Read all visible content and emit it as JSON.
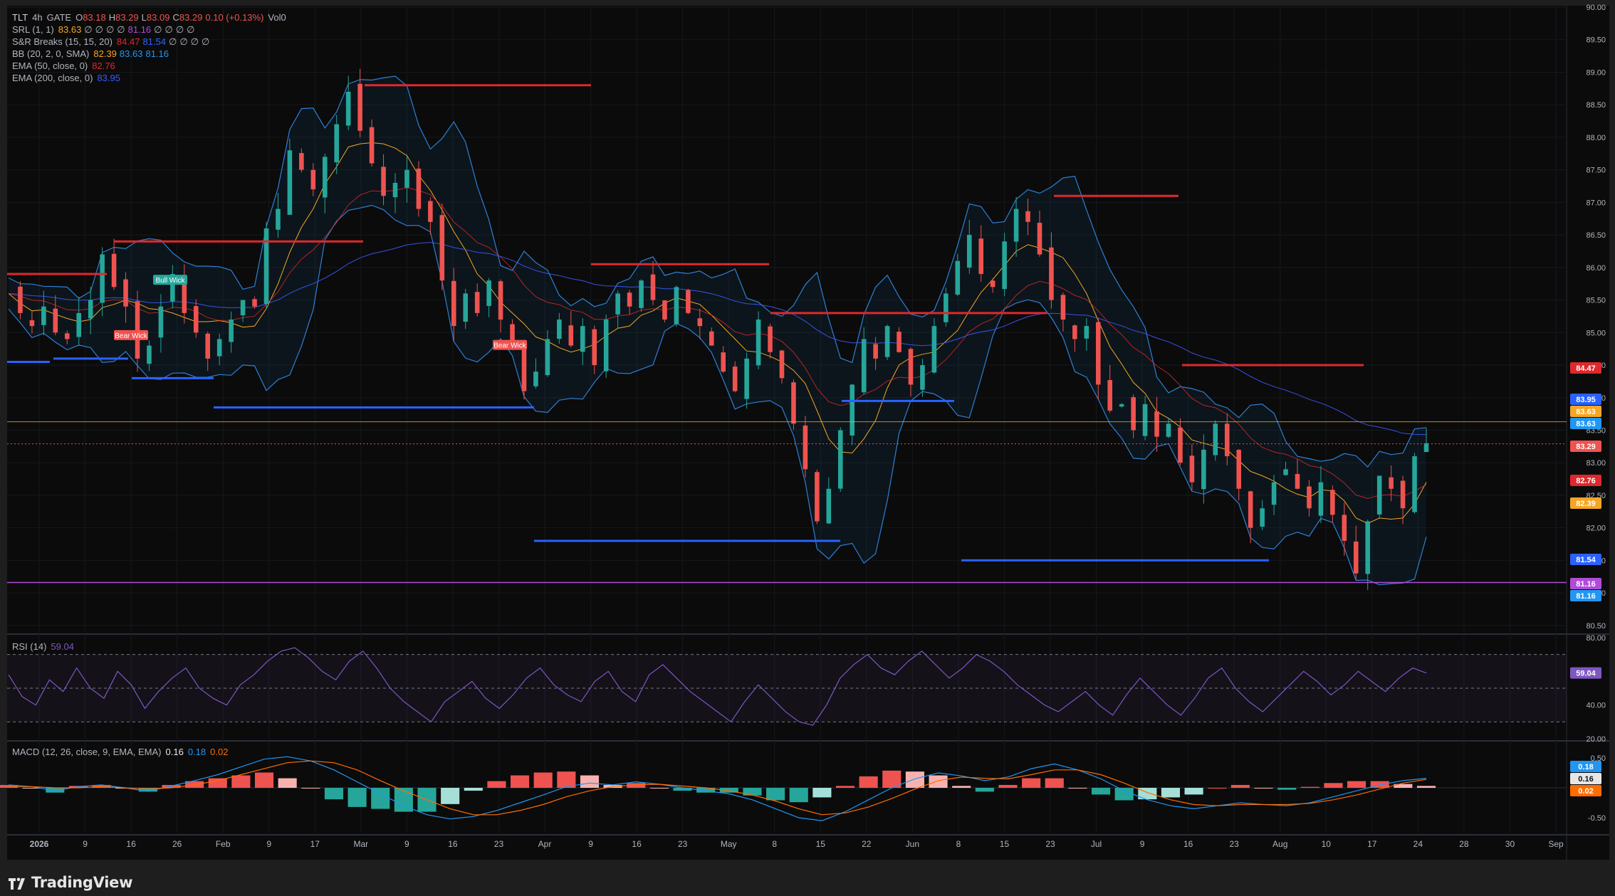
{
  "header": {
    "symbol": "TLT",
    "interval": "4h",
    "exchange": "GATE",
    "open_label": "O",
    "open": "83.18",
    "high_label": "H",
    "high": "83.29",
    "low_label": "L",
    "low": "83.09",
    "close_label": "C",
    "close": "83.29",
    "change": "0.10 (+0.13%)",
    "volume": "Vol0"
  },
  "indicators": [
    {
      "label": "SRL (1, 1)",
      "values": [
        "83.63",
        "∅",
        "∅",
        "∅",
        "∅",
        "81.16",
        "∅",
        "∅",
        "∅",
        "∅"
      ],
      "colors": [
        "#f5a623",
        "#b2b5be",
        "#b2b5be",
        "#b2b5be",
        "#b2b5be",
        "#b04cd9",
        "#b2b5be",
        "#b2b5be",
        "#b2b5be",
        "#b2b5be"
      ]
    },
    {
      "label": "S&R Breaks (15, 15, 20)",
      "values": [
        "84.47",
        "81.54",
        "∅",
        "∅",
        "∅",
        "∅"
      ],
      "colors": [
        "#e0282c",
        "#2962ff",
        "#b2b5be",
        "#b2b5be",
        "#b2b5be",
        "#b2b5be"
      ]
    },
    {
      "label": "BB (20, 2, 0, SMA)",
      "values": [
        "82.39",
        "83.63",
        "81.16"
      ],
      "colors": [
        "#f5a623",
        "#2196f3",
        "#2196f3"
      ]
    },
    {
      "label": "EMA (50, close, 0)",
      "values": [
        "82.76"
      ],
      "colors": [
        "#e0282c"
      ]
    },
    {
      "label": "EMA (200, close, 0)",
      "values": [
        "83.95"
      ],
      "colors": [
        "#3d5afe"
      ]
    }
  ],
  "colors": {
    "up": "#26a69a",
    "down": "#ef5350",
    "resistance": "#e0282c",
    "support": "#2962ff",
    "bb": "#2f7fd6",
    "ema50": "#e0282c",
    "ema200": "#3d5afe",
    "basis": "#f5a623",
    "rsi": "#7e57c2",
    "macd": "#2196f3",
    "signal": "#ff6d00"
  },
  "chart_data": [
    {
      "type": "candlestick",
      "title": "",
      "y_axis_ticks": [
        "90.00",
        "89.50",
        "89.00",
        "88.50",
        "88.00",
        "87.50",
        "87.00",
        "86.50",
        "86.00",
        "85.50",
        "85.00",
        "84.50",
        "84.00",
        "83.50",
        "83.00",
        "82.50",
        "82.00",
        "81.50",
        "81.00",
        "80.50"
      ],
      "ylim": [
        80.4,
        90.0
      ],
      "x_axis_ticks": [
        "2026",
        "9",
        "16",
        "26",
        "Feb",
        "9",
        "17",
        "Mar",
        "9",
        "16",
        "23",
        "Apr",
        "9",
        "16",
        "23",
        "May",
        "8",
        "15",
        "22",
        "Jun",
        "8",
        "15",
        "23",
        "Jul",
        "9",
        "16",
        "23",
        "Aug",
        "10",
        "17",
        "24",
        "28",
        "30",
        "Sep"
      ],
      "close_path": [
        85.6,
        85.3,
        85.1,
        85.4,
        85.0,
        84.9,
        85.3,
        85.5,
        86.2,
        85.7,
        85.4,
        84.6,
        84.8,
        85.4,
        85.9,
        85.3,
        85.0,
        84.6,
        84.9,
        85.2,
        85.5,
        85.4,
        86.6,
        86.9,
        87.8,
        87.5,
        87.2,
        87.7,
        88.2,
        88.7,
        88.1,
        87.6,
        87.1,
        87.3,
        87.5,
        86.9,
        86.7,
        85.8,
        85.1,
        85.6,
        85.3,
        85.8,
        85.2,
        84.8,
        84.1,
        84.4,
        84.9,
        85.2,
        84.8,
        85.1,
        84.5,
        85.2,
        85.6,
        85.4,
        85.8,
        85.5,
        85.2,
        85.7,
        85.3,
        85.1,
        84.8,
        84.4,
        84.1,
        84.6,
        85.2,
        84.7,
        84.3,
        83.6,
        82.9,
        82.1,
        82.6,
        83.5,
        84.2,
        84.9,
        84.6,
        85.1,
        84.7,
        84.2,
        84.5,
        85.1,
        85.6,
        86.1,
        86.5,
        85.9,
        85.7,
        86.4,
        86.9,
        86.7,
        86.2,
        85.5,
        85.2,
        84.9,
        85.1,
        84.2,
        83.8,
        83.9,
        83.5,
        83.9,
        83.4,
        83.6,
        83.0,
        82.7,
        83.2,
        83.6,
        83.1,
        82.6,
        82.0,
        82.3,
        82.7,
        82.9,
        82.6,
        82.3,
        82.7,
        82.2,
        81.8,
        81.3,
        82.1,
        82.8,
        82.6,
        82.3,
        83.1,
        83.3
      ],
      "resistance_levels": [
        85.9,
        86.4,
        88.8,
        86.05,
        85.3,
        87.1,
        84.5
      ],
      "support_levels": [
        84.55,
        84.6,
        84.3,
        83.85,
        81.8,
        83.95,
        81.5
      ],
      "labels": [
        "Bull Wick",
        "Bear Wick",
        "Bear Wick"
      ],
      "price_axis_labels": [
        {
          "value": "84.47",
          "bg": "#e0282c"
        },
        {
          "value": "83.95",
          "bg": "#2962ff"
        },
        {
          "value": "83.63",
          "bg": "#f5a623"
        },
        {
          "value": "83.63",
          "bg": "#2196f3"
        },
        {
          "value": "83.29",
          "bg": "#ef5350"
        },
        {
          "value": "82.76",
          "bg": "#e0282c"
        },
        {
          "value": "82.39",
          "bg": "#f5a623"
        },
        {
          "value": "81.54",
          "bg": "#2962ff"
        },
        {
          "value": "81.16",
          "bg": "#b04cd9"
        },
        {
          "value": "81.16",
          "bg": "#2196f3"
        }
      ],
      "horizontal_lines": [
        83.63,
        81.16
      ]
    },
    {
      "type": "line",
      "title": "RSI (14)",
      "value": "59.04",
      "y_axis_ticks": [
        "80.00",
        "40.00",
        "20.00"
      ],
      "ylim": [
        20,
        80
      ],
      "bands": [
        70,
        50,
        30
      ],
      "series": [
        {
          "name": "RSI",
          "values": [
            58,
            45,
            40,
            55,
            48,
            62,
            50,
            44,
            60,
            52,
            38,
            48,
            56,
            62,
            50,
            44,
            40,
            52,
            58,
            66,
            72,
            74,
            68,
            60,
            55,
            66,
            72,
            62,
            50,
            42,
            36,
            30,
            42,
            48,
            54,
            44,
            38,
            46,
            56,
            62,
            52,
            46,
            42,
            54,
            60,
            48,
            42,
            58,
            64,
            56,
            48,
            42,
            36,
            30,
            42,
            52,
            44,
            36,
            30,
            28,
            40,
            56,
            64,
            70,
            62,
            58,
            66,
            72,
            64,
            56,
            62,
            70,
            66,
            60,
            52,
            46,
            40,
            36,
            42,
            48,
            40,
            34,
            46,
            56,
            48,
            40,
            34,
            44,
            56,
            62,
            50,
            42,
            36,
            44,
            52,
            60,
            54,
            46,
            52,
            60,
            54,
            48,
            56,
            62,
            59
          ]
        }
      ]
    },
    {
      "type": "histogram+line",
      "title": "MACD (12, 26, close, 9, EMA, EMA)",
      "values": [
        "0.16",
        "0.18",
        "0.02"
      ],
      "y_axis_ticks": [
        "0.50",
        "-0.50"
      ],
      "ylim": [
        -0.75,
        0.75
      ],
      "series": [
        {
          "name": "MACD",
          "values": [
            0.05,
            0.02,
            -0.05,
            0.02,
            0.05,
            0.0,
            -0.06,
            0.03,
            0.12,
            0.22,
            0.35,
            0.48,
            0.52,
            0.45,
            0.3,
            0.1,
            -0.1,
            -0.3,
            -0.45,
            -0.52,
            -0.48,
            -0.38,
            -0.25,
            -0.12,
            0.02,
            0.08,
            0.05,
            0.1,
            0.06,
            0.0,
            -0.05,
            -0.1,
            -0.2,
            -0.35,
            -0.5,
            -0.55,
            -0.4,
            -0.2,
            0.0,
            0.15,
            0.25,
            0.2,
            0.12,
            0.18,
            0.32,
            0.4,
            0.3,
            0.15,
            -0.05,
            -0.2,
            -0.3,
            -0.35,
            -0.3,
            -0.25,
            -0.28,
            -0.3,
            -0.25,
            -0.15,
            -0.05,
            0.05,
            0.12,
            0.16
          ]
        },
        {
          "name": "Signal",
          "values": [
            0.02,
            0.02,
            0.0,
            0.0,
            0.02,
            0.0,
            -0.02,
            0.0,
            0.05,
            0.12,
            0.22,
            0.32,
            0.42,
            0.45,
            0.42,
            0.3,
            0.12,
            -0.05,
            -0.2,
            -0.35,
            -0.45,
            -0.45,
            -0.38,
            -0.28,
            -0.15,
            -0.05,
            0.02,
            0.05,
            0.06,
            0.03,
            0.0,
            -0.05,
            -0.12,
            -0.22,
            -0.35,
            -0.45,
            -0.42,
            -0.32,
            -0.18,
            -0.02,
            0.12,
            0.18,
            0.16,
            0.15,
            0.22,
            0.3,
            0.3,
            0.22,
            0.08,
            -0.08,
            -0.2,
            -0.28,
            -0.3,
            -0.28,
            -0.28,
            -0.28,
            -0.26,
            -0.2,
            -0.12,
            -0.02,
            0.08,
            0.14
          ]
        }
      ]
    }
  ],
  "watermark": {
    "logo_text": "TradingView"
  }
}
